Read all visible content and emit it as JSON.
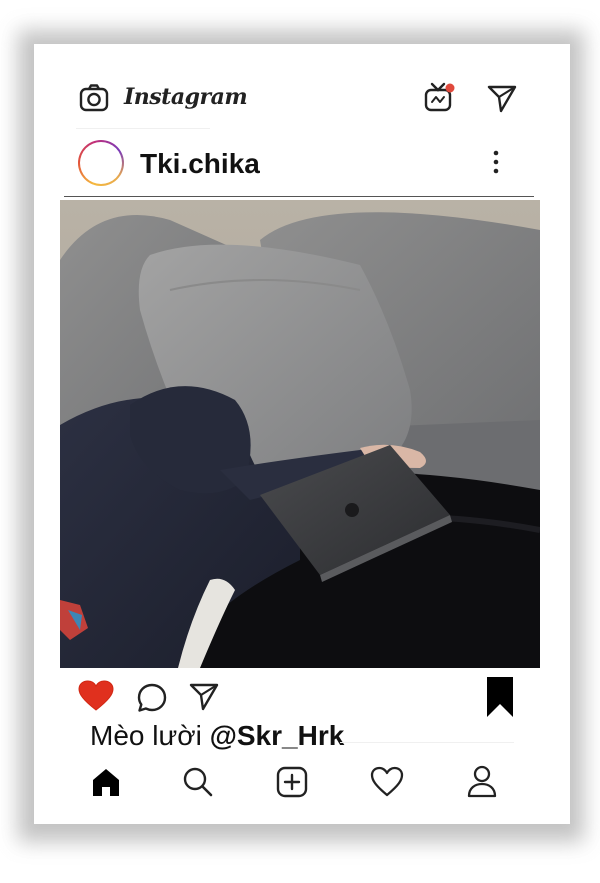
{
  "app": {
    "name": "Instagram"
  },
  "header": {
    "wordmark": "Instagram",
    "icons": [
      "camera-icon",
      "igtv-icon",
      "direct-message-icon"
    ],
    "igtv_badge_color": "#e0493c"
  },
  "post": {
    "username": "Tki.chika",
    "more_icon": "more-vertical-icon",
    "photo_alt": "photo"
  },
  "actions": {
    "like": {
      "icon": "heart-filled-icon",
      "color": "#e0301e",
      "liked": true
    },
    "comment": {
      "icon": "comment-icon"
    },
    "share": {
      "icon": "send-icon"
    },
    "save": {
      "icon": "bookmark-filled-icon",
      "saved": true
    }
  },
  "caption": {
    "text": "Mèo lười ",
    "mention": "@Skr_Hrk"
  },
  "bottom_nav": {
    "items": [
      "home-icon",
      "search-icon",
      "new-post-icon",
      "activity-icon",
      "profile-icon"
    ]
  },
  "colors": {
    "text": "#111111",
    "like": "#e0301e",
    "frame_shadow": "#b9b9b9"
  }
}
